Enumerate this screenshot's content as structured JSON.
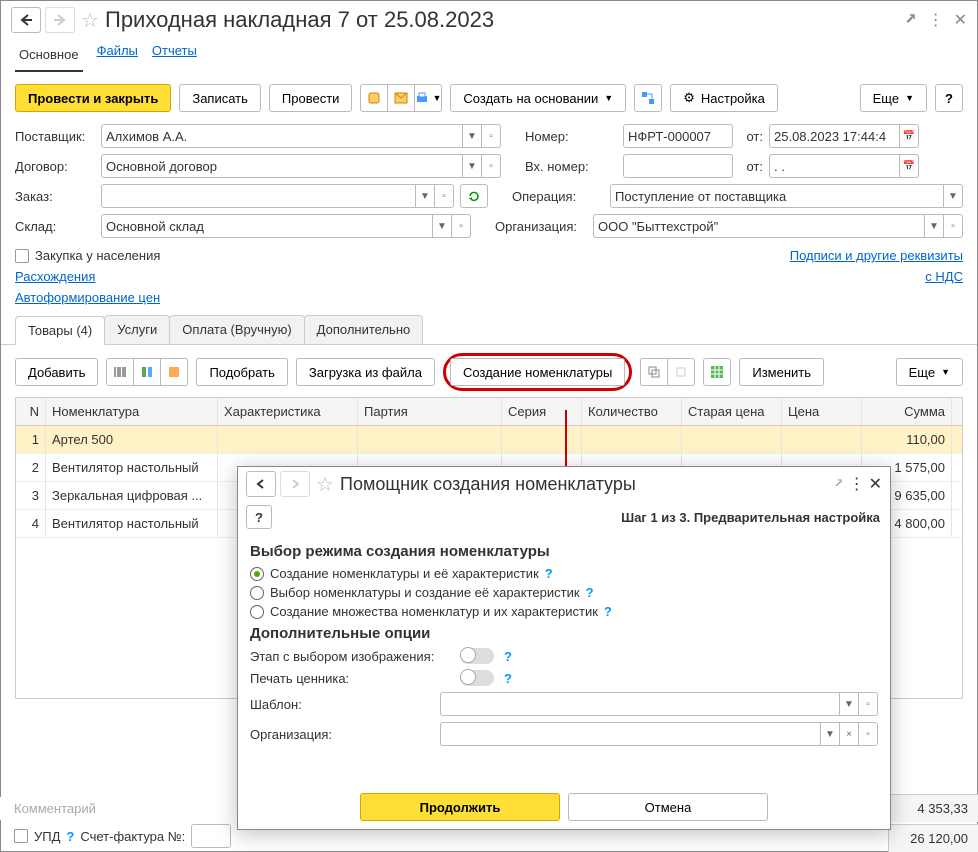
{
  "title": "Приходная накладная 7 от 25.08.2023",
  "nav_tabs": {
    "main": "Основное",
    "files": "Файлы",
    "reports": "Отчеты"
  },
  "toolbar": {
    "post_close": "Провести и закрыть",
    "save": "Записать",
    "post": "Провести",
    "create_based": "Создать на основании",
    "settings": "Настройка",
    "more": "Еще"
  },
  "labels": {
    "supplier": "Поставщик:",
    "contract": "Договор:",
    "order": "Заказ:",
    "warehouse": "Склад:",
    "number": "Номер:",
    "in_number": "Вх. номер:",
    "operation": "Операция:",
    "org": "Организация:",
    "from": "от:",
    "pop_purchase": "Закупка у населения",
    "signatures": "Подписи и другие реквизиты",
    "discrep": "Расхождения",
    "vat": "с НДС",
    "autoprice": "Автоформирование цен",
    "comment": "Комментарий",
    "upd": "УПД",
    "invoice": "Счет-фактура №:"
  },
  "fields": {
    "supplier": "Алхимов А.А.",
    "contract": "Основной договор",
    "order": "",
    "warehouse": "Основной склад",
    "number": "НФРТ-000007",
    "date": "25.08.2023 17:44:4",
    "in_number": "",
    "in_date": "  .  .",
    "operation": "Поступление от поставщика",
    "org": "ООО \"Быттехстрой\""
  },
  "tabs2": {
    "goods": "Товары (4)",
    "services": "Услуги",
    "payment": "Оплата (Вручную)",
    "extra": "Дополнительно"
  },
  "toolbar2": {
    "add": "Добавить",
    "pick": "Подобрать",
    "load": "Загрузка из файла",
    "create_nomen": "Создание номенклатуры",
    "edit": "Изменить",
    "more": "Еще"
  },
  "columns": {
    "n": "N",
    "nomen": "Номенклатура",
    "char": "Характеристика",
    "batch": "Партия",
    "series": "Серия",
    "qty": "Количество",
    "old": "Старая цена",
    "price": "Цена",
    "sum": "Сумма"
  },
  "rows": [
    {
      "n": "1",
      "nomen": "Артел 500",
      "sum": "110,00"
    },
    {
      "n": "2",
      "nomen": "Вентилятор настольный",
      "sum": "1 575,00"
    },
    {
      "n": "3",
      "nomen": "Зеркальная цифровая ...",
      "sum": "9 635,00"
    },
    {
      "n": "4",
      "nomen": "Вентилятор настольный",
      "sum": "4 800,00"
    }
  ],
  "totals": {
    "subtotal": "4 353,33",
    "total": "26 120,00"
  },
  "dialog": {
    "title": "Помощник создания номенклатуры",
    "step": "Шаг 1 из 3. Предварительная настройка",
    "h1": "Выбор режима создания номенклатуры",
    "r1": "Создание номенклатуры и её характеристик",
    "r2": "Выбор номенклатуры и создание её характеристик",
    "r3": "Создание множества номенклатур и их характеристик",
    "h2": "Дополнительные опции",
    "o1": "Этап с выбором изображения:",
    "o2": "Печать ценника:",
    "tmpl": "Шаблон:",
    "org": "Организация:",
    "continue": "Продолжить",
    "cancel": "Отмена"
  }
}
